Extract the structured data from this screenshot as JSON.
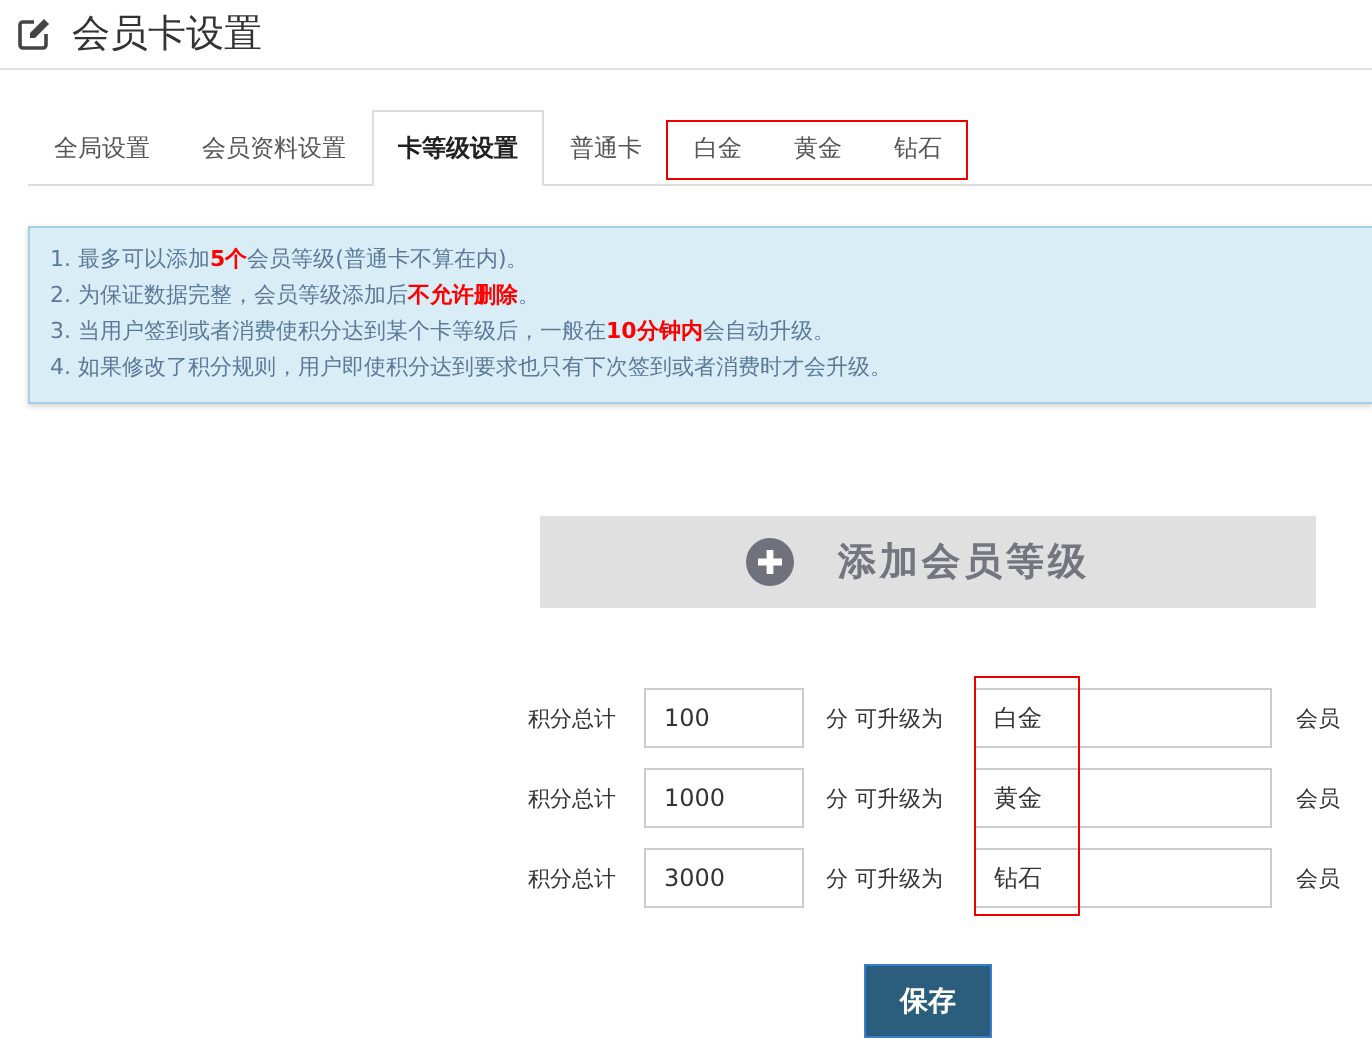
{
  "page": {
    "title": "会员卡设置"
  },
  "tabs": [
    {
      "label": "全局设置",
      "selected": false,
      "highlighted": false
    },
    {
      "label": "会员资料设置",
      "selected": false,
      "highlighted": false
    },
    {
      "label": "卡等级设置",
      "selected": true,
      "highlighted": false
    },
    {
      "label": "普通卡",
      "selected": false,
      "highlighted": false
    },
    {
      "label": "白金",
      "selected": false,
      "highlighted": true
    },
    {
      "label": "黄金",
      "selected": false,
      "highlighted": true
    },
    {
      "label": "钻石",
      "selected": false,
      "highlighted": true
    }
  ],
  "notes": [
    "1. 最多可以添加**5个**会员等级(普通卡不算在内)。",
    "2. 为保证数据完整，会员等级添加后**不允许删除**。",
    "3. 当用户签到或者消费使积分达到某个卡等级后，一般在**10分钟内**会自动升级。",
    "4. 如果修改了积分规则，用户即使积分达到要求也只有下次签到或者消费时才会升级。"
  ],
  "add_button": {
    "label": "添加会员等级"
  },
  "levels": {
    "name_fields_highlighted": true,
    "rows": [
      {
        "label": "积分总计",
        "points": "100",
        "unit": "分 可升级为",
        "name": "白金",
        "suffix": "会员"
      },
      {
        "label": "积分总计",
        "points": "1000",
        "unit": "分 可升级为",
        "name": "黄金",
        "suffix": "会员"
      },
      {
        "label": "积分总计",
        "points": "3000",
        "unit": "分 可升级为",
        "name": "钻石",
        "suffix": "会员"
      }
    ]
  },
  "save_button": {
    "label": "保存"
  }
}
